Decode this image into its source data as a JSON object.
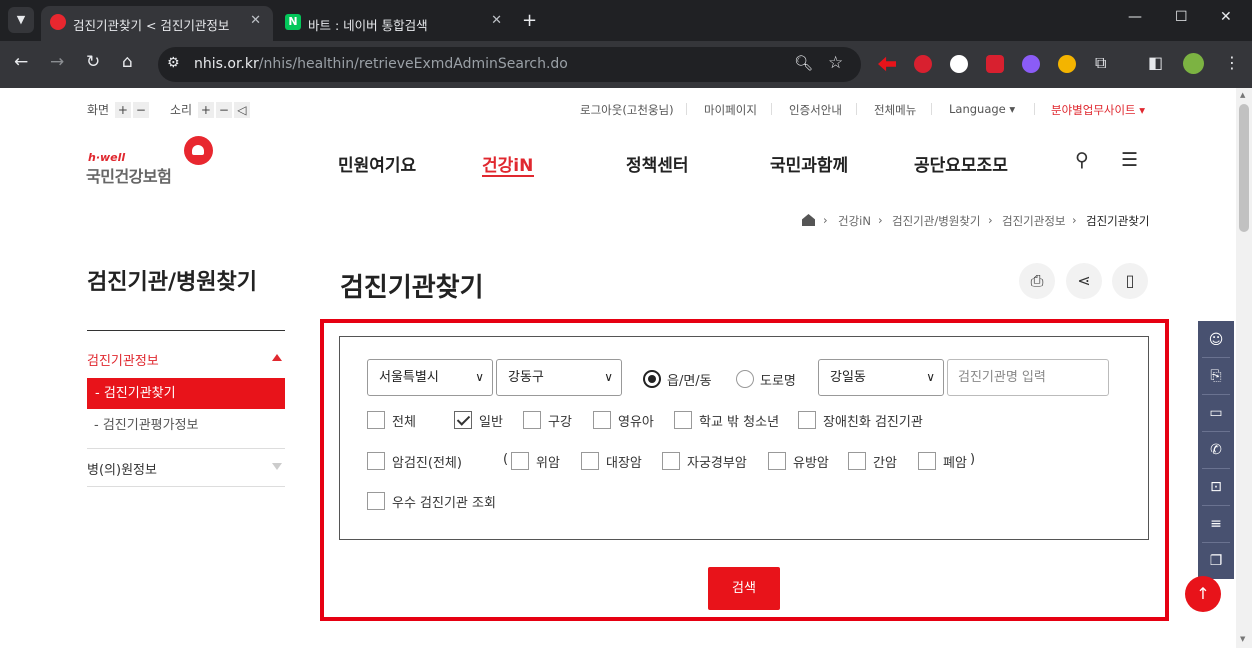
{
  "browser": {
    "tabs": [
      {
        "title": "검진기관찾기 < 검진기관정보",
        "active": true,
        "favicon_color": "#e8272f"
      },
      {
        "title": "바트 : 네이버 통합검색",
        "active": false,
        "favicon_color": "#03c75a",
        "favicon_letter": "N"
      }
    ],
    "url_domain": "nhis.or.kr",
    "url_path": "/nhis/healthin/retrieveExmdAdminSearch.do"
  },
  "util": {
    "screen_label": "화면",
    "sound_label": "소리",
    "plus": "+",
    "minus": "−",
    "links": [
      "로그아웃(고천웅님)",
      "마이페이지",
      "인증서안내",
      "전체메뉴",
      "Language ▾",
      "분야별업무사이트 ▾"
    ]
  },
  "logo": {
    "tagline": "h·well",
    "name": "국민건강보험"
  },
  "gnb": [
    "민원여기요",
    "건강iN",
    "정책센터",
    "국민과함께",
    "공단요모조모"
  ],
  "breadcrumb": [
    "건강iN",
    "검진기관/병원찾기",
    "검진기관정보",
    "검진기관찾기"
  ],
  "lnb": {
    "title": "검진기관/병원찾기",
    "section": "검진기관정보",
    "active_item": "-  검진기관찾기",
    "sub_item": "-  검진기관평가정보",
    "section2": "병(의)원정보"
  },
  "page_title": "검진기관찾기",
  "form": {
    "sido": "서울특별시",
    "sigungu": "강동구",
    "radio_options": [
      {
        "label": "읍/면/동",
        "checked": true
      },
      {
        "label": "도로명",
        "checked": false
      }
    ],
    "dong": "강일동",
    "name_placeholder": "검진기관명 입력",
    "row1": [
      {
        "label": "전체",
        "checked": false
      },
      {
        "label": "일반",
        "checked": true
      },
      {
        "label": "구강",
        "checked": false
      },
      {
        "label": "영유아",
        "checked": false
      },
      {
        "label": "학교 밖 청소년",
        "checked": false
      },
      {
        "label": "장애친화 검진기관",
        "checked": false
      }
    ],
    "cancer_all": "암검진(전체)",
    "paren_open": "(",
    "paren_close": ")",
    "cancers": [
      {
        "label": "위암",
        "checked": false
      },
      {
        "label": "대장암",
        "checked": false
      },
      {
        "label": "자궁경부암",
        "checked": false
      },
      {
        "label": "유방암",
        "checked": false
      },
      {
        "label": "간암",
        "checked": false
      },
      {
        "label": "폐암",
        "checked": false
      }
    ],
    "excellent": "우수 검진기관 조회",
    "search_button": "검색"
  },
  "colors": {
    "accent": "#e8131a",
    "quick_menu": "#485170",
    "highlight": "#e60012"
  }
}
